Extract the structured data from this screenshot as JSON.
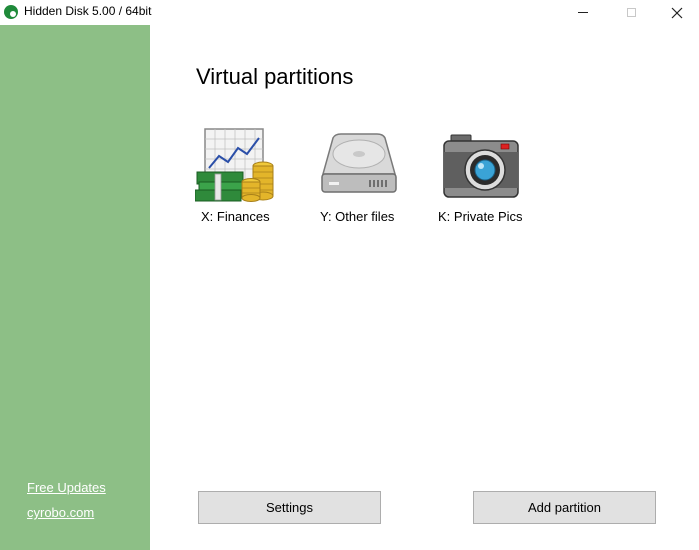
{
  "window": {
    "title": "Hidden Disk 5.00 / 64bit",
    "controls": {
      "minimize_icon": "minimize-icon",
      "maximize_icon": "maximize-icon",
      "close_glyph": "✕"
    }
  },
  "sidebar": {
    "background": "#8dbf86",
    "links": {
      "updates": "Free Updates",
      "site": "cyrobo.com"
    }
  },
  "main": {
    "title": "Virtual partitions",
    "partitions": [
      {
        "label": "X: Finances",
        "icon": "finances-chart-money-icon"
      },
      {
        "label": "Y: Other files",
        "icon": "hard-drive-icon"
      },
      {
        "label": "K: Private Pics",
        "icon": "camera-icon"
      }
    ],
    "buttons": {
      "settings": "Settings",
      "add_partition": "Add partition"
    }
  }
}
